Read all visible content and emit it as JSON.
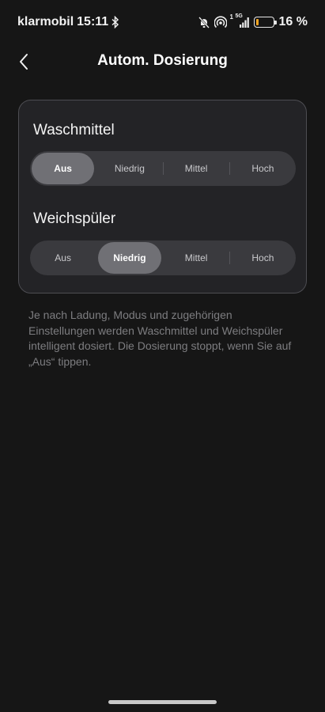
{
  "status_bar": {
    "carrier": "klarmobil",
    "time": "15:11",
    "network_label": "5G",
    "sim_label": "1",
    "battery_percent": "16 %",
    "battery_level": 0.16,
    "battery_color": "#f5a623"
  },
  "header": {
    "title": "Autom. Dosierung",
    "back_icon": "chevron-left-icon"
  },
  "card": {
    "detergent": {
      "label": "Waschmittel",
      "options": [
        "Aus",
        "Niedrig",
        "Mittel",
        "Hoch"
      ],
      "selected": "Aus"
    },
    "softener": {
      "label": "Weichspüler",
      "options": [
        "Aus",
        "Niedrig",
        "Mittel",
        "Hoch"
      ],
      "selected": "Niedrig"
    }
  },
  "description": "Je nach Ladung, Modus und zugehörigen Einstellungen werden Waschmittel und Weichspüler intelligent dosiert. Die Dosierung stoppt, wenn Sie auf „Aus“ tippen.",
  "colors": {
    "background": "#161616",
    "card": "#232326",
    "segment_active": "#707075"
  }
}
